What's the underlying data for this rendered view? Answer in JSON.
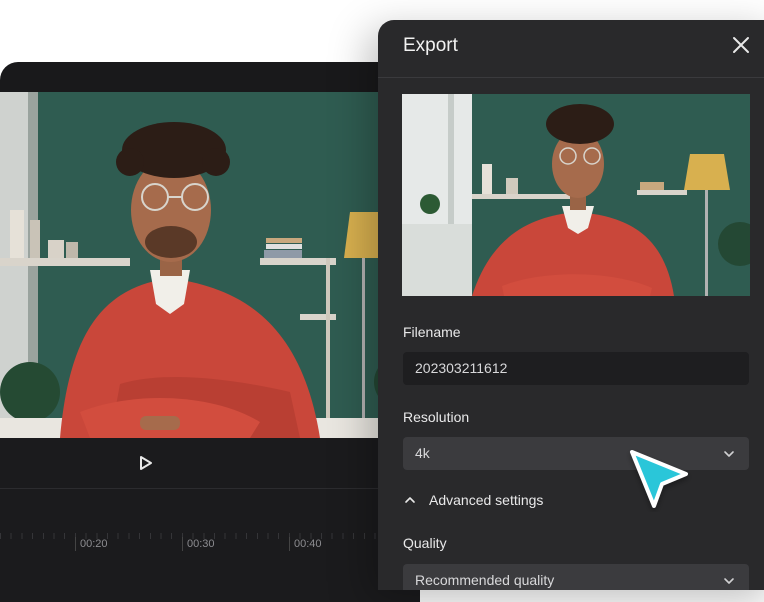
{
  "player": {
    "timeline_ticks": [
      "00:20",
      "00:30",
      "00:40"
    ]
  },
  "export_panel": {
    "title": "Export",
    "filename_label": "Filename",
    "filename_value": "202303211612",
    "resolution_label": "Resolution",
    "resolution_value": "4k",
    "advanced_label": "Advanced settings",
    "quality_label": "Quality",
    "quality_value": "Recommended quality"
  },
  "colors": {
    "panel_bg": "#29292b",
    "accent_cursor": "#29c6d9"
  }
}
